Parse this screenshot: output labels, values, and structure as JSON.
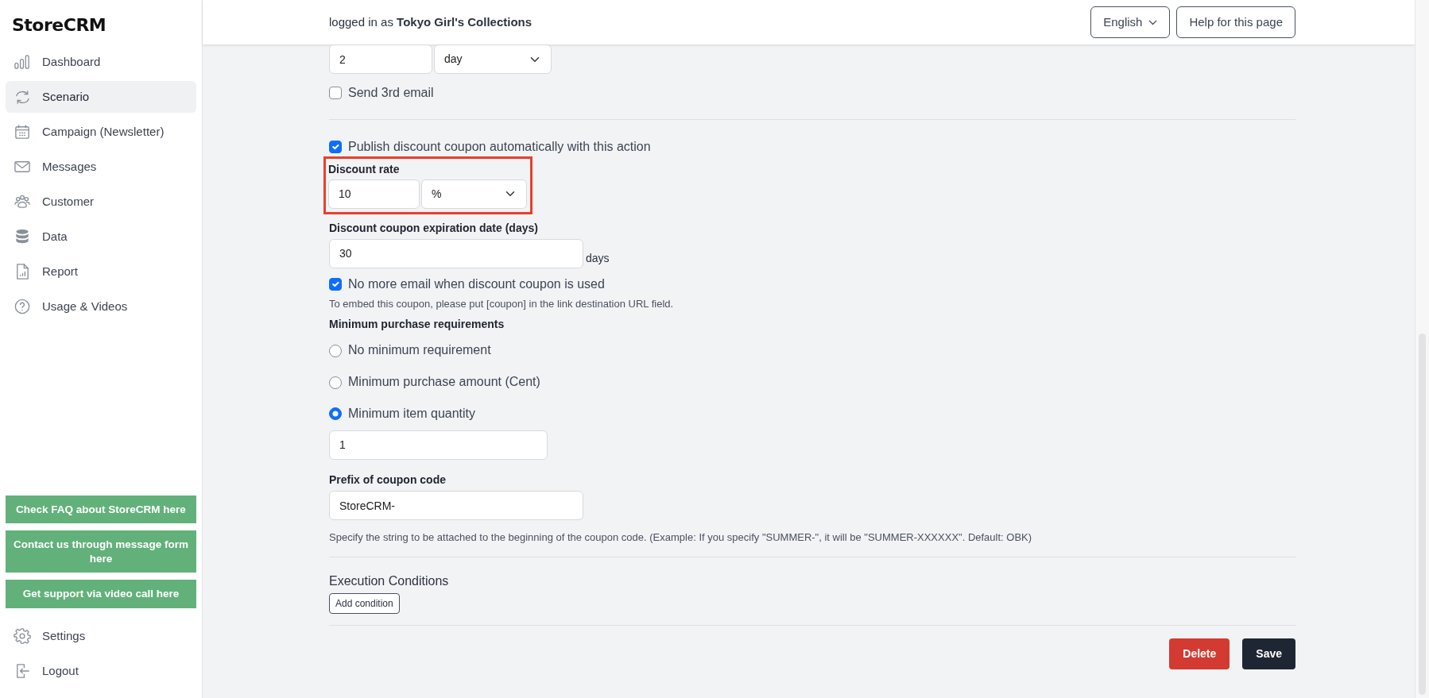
{
  "sidebar": {
    "logo": "StoreCRM",
    "items": [
      {
        "label": "Dashboard",
        "selected": false
      },
      {
        "label": "Scenario",
        "selected": true
      },
      {
        "label": "Campaign (Newsletter)",
        "selected": false
      },
      {
        "label": "Messages",
        "selected": false
      },
      {
        "label": "Customer",
        "selected": false
      },
      {
        "label": "Data",
        "selected": false
      },
      {
        "label": "Report",
        "selected": false
      },
      {
        "label": "Usage & Videos",
        "selected": false
      }
    ],
    "support_buttons": [
      "Check FAQ about StoreCRM here",
      "Contact us through message form here",
      "Get support via video call here"
    ],
    "bottom_items": [
      {
        "label": "Settings"
      },
      {
        "label": "Logout"
      }
    ]
  },
  "header": {
    "logged_in": "logged in as **Tokyo Girl's Collections**",
    "language": "English",
    "help_button": "Help for this page"
  },
  "form": {
    "interval": {
      "value": "2",
      "unit": "day"
    },
    "send_3rd_email": {
      "label": "Send 3rd email",
      "checked": false
    },
    "publish_coupon": {
      "label": "Publish discount coupon automatically with this action",
      "checked": true
    },
    "discount_rate": {
      "label": "Discount rate",
      "value": "10",
      "unit": "%",
      "highlighted": true
    },
    "expiration": {
      "label": "Discount coupon expiration date (days)",
      "value": "30",
      "suffix": "days"
    },
    "no_more_email": {
      "label": "No more email when discount coupon is used",
      "checked": true
    },
    "embed_hint": "To embed this coupon, please put [coupon] in the link destination URL field.",
    "minimum_requirements": {
      "label": "Minimum purchase requirements",
      "options": [
        {
          "label": "No minimum requirement",
          "selected": false
        },
        {
          "label": "Minimum purchase amount (Cent)",
          "selected": false
        },
        {
          "label": "Minimum item quantity",
          "selected": true
        }
      ],
      "value": "1"
    },
    "prefix": {
      "label": "Prefix of coupon code",
      "value": "StoreCRM-",
      "hint": "Specify the string to be attached to the beginning of the coupon code. (Example: If you specify \"SUMMER-\", it will be \"SUMMER-XXXXXX\". Default: OBK)"
    },
    "execution_conditions": {
      "title": "Execution Conditions",
      "button": "Add condition"
    },
    "actions": [
      {
        "label": "Delete",
        "kind": "danger"
      },
      {
        "label": "Save",
        "kind": "primary"
      }
    ]
  }
}
